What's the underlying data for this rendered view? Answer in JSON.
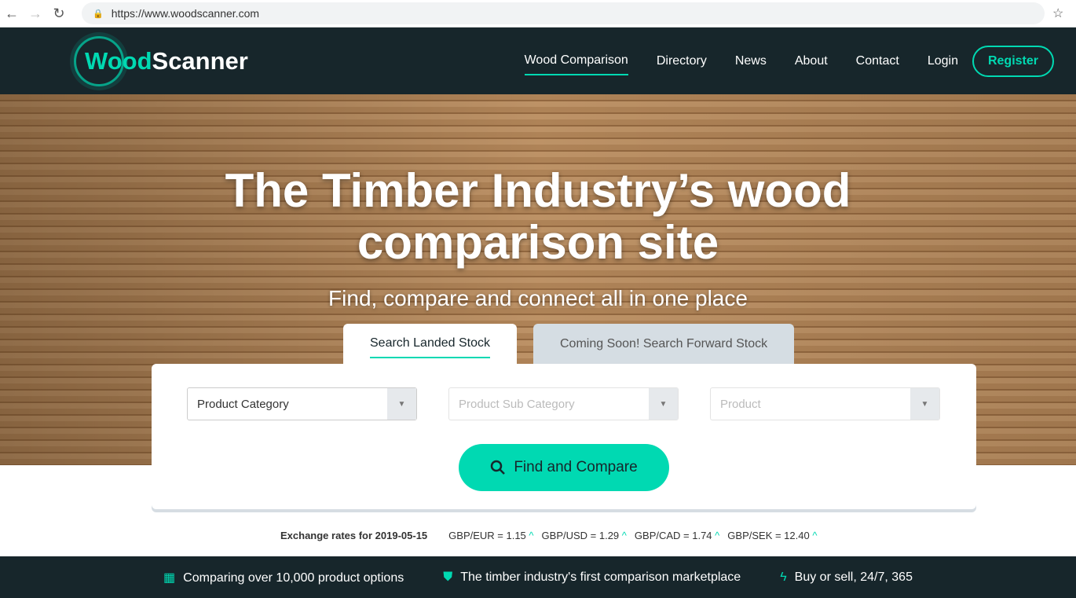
{
  "browser": {
    "url": "https://www.woodscanner.com"
  },
  "logo": {
    "part1": "Wood",
    "part2": "Scanner"
  },
  "nav": {
    "items": [
      "Wood Comparison",
      "Directory",
      "News",
      "About",
      "Contact",
      "Login"
    ],
    "register": "Register"
  },
  "hero": {
    "title_line1": "The Timber Industry’s wood",
    "title_line2": "comparison site",
    "subtitle": "Find, compare and connect all in one place"
  },
  "tabs": [
    "Search Landed Stock",
    "Coming Soon! Search Forward Stock"
  ],
  "search": {
    "category": "Product Category",
    "sub_category": "Product Sub Category",
    "product": "Product",
    "button": "Find and Compare"
  },
  "exchange": {
    "label": "Exchange rates for 2019-05-15",
    "rates": [
      "GBP/EUR = 1.15",
      "GBP/USD = 1.29",
      "GBP/CAD = 1.74",
      "GBP/SEK = 12.40"
    ]
  },
  "footer": [
    "Comparing over 10,000 product options",
    "The timber industry's first comparison marketplace",
    "Buy or sell, 24/7, 365"
  ],
  "colors": {
    "accent": "#00d9b2",
    "dark": "#17262b"
  }
}
